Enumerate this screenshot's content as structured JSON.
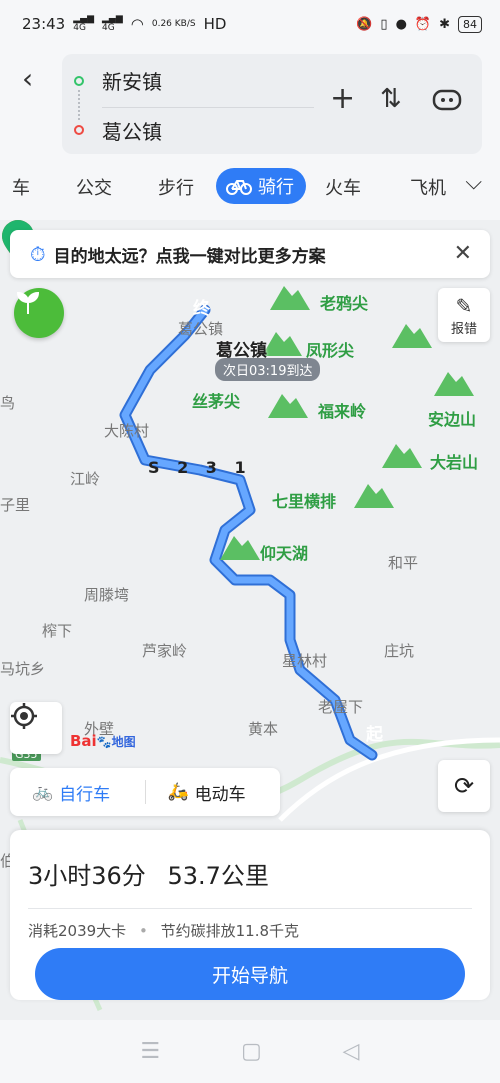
{
  "status": {
    "time": "23:43",
    "signal1": "4G",
    "signal2": "4G",
    "speed": "0.26 KB/S",
    "hd": "HD",
    "battery": "84"
  },
  "route": {
    "start": "新安镇",
    "end": "葛公镇"
  },
  "modes": {
    "items": [
      "车",
      "公交",
      "步行",
      "骑行",
      "火车",
      "飞机"
    ],
    "active": "骑行"
  },
  "banner": {
    "text": "目的地太远？点我一键对比更多方案"
  },
  "map": {
    "report_label": "报错",
    "dest_marker": "终",
    "start_marker": "起",
    "dest_name": "葛公镇",
    "eta": "次日03:19到达",
    "road_label": "S 2 3 1",
    "highway": "G35",
    "logo": "Bai",
    "logo_sub": "地图",
    "places": [
      "大陈村",
      "江岭",
      "子里",
      "周滕塆",
      "榨下",
      "马坑乡",
      "芦家岭",
      "外壁",
      "黄本",
      "星林村",
      "老屋下",
      "庄坑",
      "和平",
      "葛公镇",
      "鸟",
      "伯"
    ],
    "scenic": [
      "老鸦尖",
      "凤形尖",
      "丝茅尖",
      "福来岭",
      "安边山",
      "大岩山",
      "七里横排",
      "仰天湖"
    ]
  },
  "subtabs": {
    "bike": "自行车",
    "ebike": "电动车"
  },
  "summary": {
    "time": "3小时36分",
    "distance": "53.7公里",
    "calories": "消耗2039大卡",
    "carbon": "节约碳排放11.8千克",
    "start_nav": "开始导航"
  }
}
